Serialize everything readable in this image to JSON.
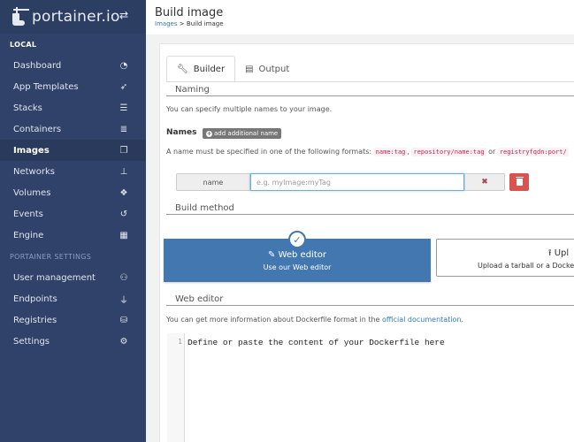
{
  "sidebar": {
    "brand": "portainer.io",
    "section_local": "LOCAL",
    "items": [
      {
        "label": "Dashboard",
        "icon": "tachometer-icon"
      },
      {
        "label": "App Templates",
        "icon": "rocket-icon"
      },
      {
        "label": "Stacks",
        "icon": "th-list-icon"
      },
      {
        "label": "Containers",
        "icon": "server-icon"
      },
      {
        "label": "Images",
        "icon": "clone-icon",
        "active": true
      },
      {
        "label": "Networks",
        "icon": "sitemap-icon"
      },
      {
        "label": "Volumes",
        "icon": "cubes-icon"
      },
      {
        "label": "Events",
        "icon": "history-icon"
      },
      {
        "label": "Engine",
        "icon": "th-icon"
      }
    ],
    "section_settings": "PORTAINER SETTINGS",
    "settings_items": [
      {
        "label": "User management",
        "icon": "users-icon"
      },
      {
        "label": "Endpoints",
        "icon": "plug-icon"
      },
      {
        "label": "Registries",
        "icon": "database-icon"
      },
      {
        "label": "Settings",
        "icon": "cogs-icon"
      }
    ]
  },
  "header": {
    "title": "Build image",
    "breadcrumb_link": "Images",
    "breadcrumb_sep": " > ",
    "breadcrumb_current": "Build image"
  },
  "tabs": [
    {
      "label": "Builder",
      "icon": "wrench-icon",
      "active": true
    },
    {
      "label": "Output",
      "icon": "file-icon"
    }
  ],
  "naming": {
    "title": "Naming",
    "help": "You can specify multiple names to your image.",
    "names_label": "Names",
    "add_button": "add additional name",
    "format_prefix": "A name must be specified in one of the following formats: ",
    "format1": "name:tag",
    "comma": ", ",
    "format2": "repository/name:tag",
    "or": " or ",
    "format3": "registryfqdn:port/",
    "name_addon": "name",
    "name_placeholder": "e.g. myImage:myTag",
    "name_value": ""
  },
  "build_method": {
    "title": "Build method",
    "web_editor_title": "Web editor",
    "web_editor_sub": "Use our Web editor",
    "upload_title": "Upl",
    "upload_sub": "Upload a tarball or a Docke"
  },
  "web_editor": {
    "title": "Web editor",
    "help_prefix": "You can get more information about Dockerfile format in the ",
    "help_link": "official documentation",
    "help_suffix": ".",
    "line_number": "1",
    "placeholder_line": "Define or paste the content of your Dockerfile here"
  },
  "colors": {
    "sidebar_bg": "#30426a",
    "primary": "#4277b0",
    "danger": "#d9534f",
    "link": "#337ab7"
  }
}
